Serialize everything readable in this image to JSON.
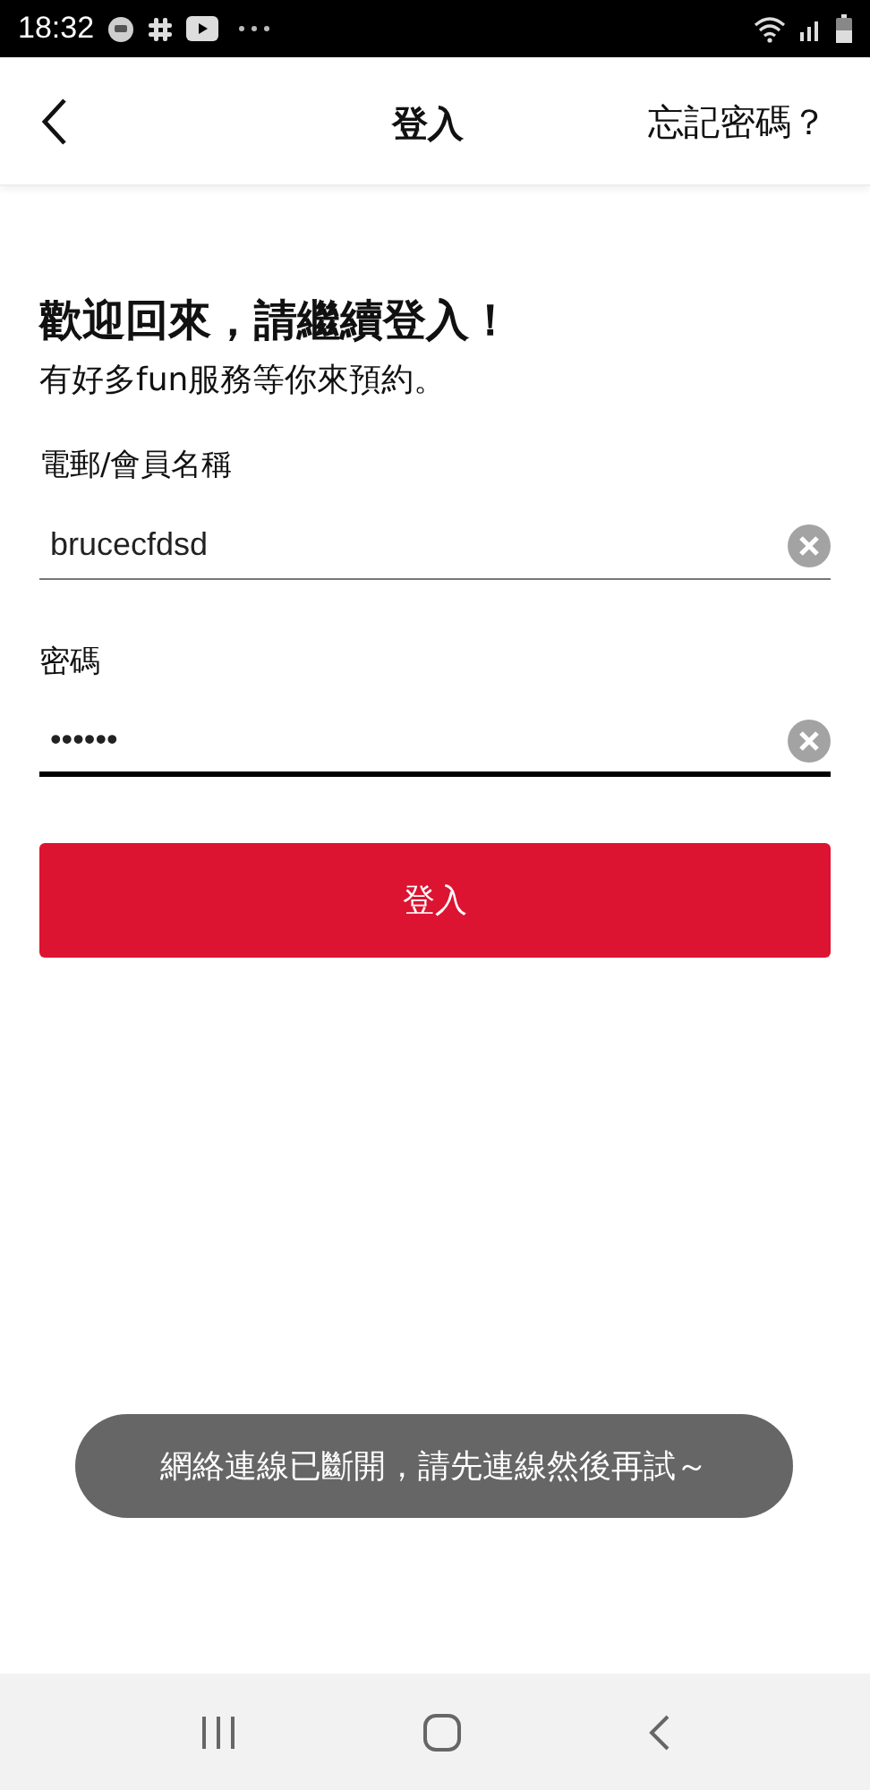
{
  "status_bar": {
    "time": "18:32"
  },
  "app_bar": {
    "title": "登入",
    "action": "忘記密碼？"
  },
  "heading": "歡迎回來，請繼續登入！",
  "subtitle": "有好多fun服務等你來預約。",
  "fields": [
    {
      "label": "電郵/會員名稱",
      "value": "brucecfdsd",
      "focused": false
    },
    {
      "label": "密碼",
      "value": "••••••",
      "focused": true
    }
  ],
  "login_button": "登入",
  "toast": "網絡連線已斷開，請先連線然後再試～"
}
